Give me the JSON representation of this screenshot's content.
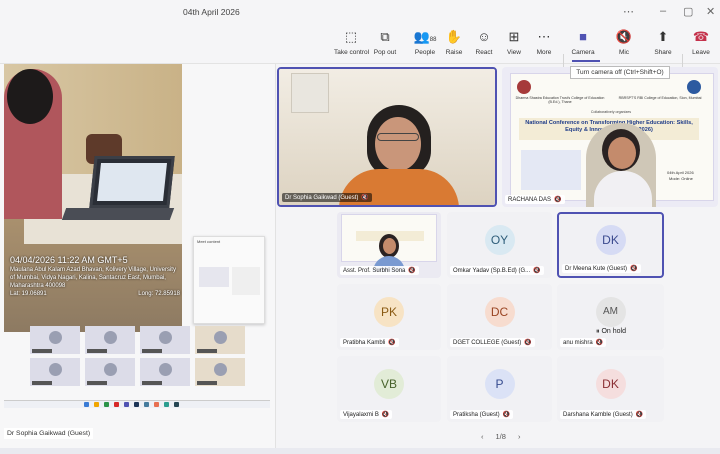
{
  "window": {
    "title": "04th April 2026"
  },
  "toolbar": {
    "take_control": "Take control",
    "pop_out": "Pop out",
    "people": "People",
    "people_count": "88",
    "raise": "Raise",
    "react": "React",
    "view": "View",
    "more": "More",
    "camera": "Camera",
    "mic": "Mic",
    "share": "Share",
    "leave": "Leave",
    "tooltip": "Turn camera off (Ctrl+Shift+O)"
  },
  "photo_overlay": {
    "timestamp": "04/04/2026 11:22 AM  GMT+5",
    "address": "Maulana Abul Kalam Azad Bhavan, Kolivery Village, University of Mumbai, Vidya Nagari, Kalina, Santacruz East, Mumbai, Maharashtra 400098",
    "lat": "Lat: 19.06891",
    "long": "Long: 72.85918"
  },
  "shared_window": {
    "header": "Meet content"
  },
  "left_name_tag": "Dr Sophia Gaikwad (Guest)",
  "slide": {
    "org": "Dharma Shastra Education Trust's College of Education (B.Ed.), Thane",
    "org2": "RBRSPT'S RBI College of Education, Sion, Mumbai",
    "collab": "Collaboratively organizes",
    "title": "National Conference on Transforming Higher Education: Skills, Equity & Innovation (NCHE 2026)",
    "date": "04th April 2026",
    "mode": "Mode: Online"
  },
  "tiles": [
    {
      "name": "Dr Sophia Gaikwad (Guest)",
      "selected": true
    },
    {
      "name": "RACHANA DAS",
      "selected": false
    },
    {
      "name": "Asst. Prof. Surbhi Sona",
      "selected": false
    },
    {
      "name": "Omkar Yadav (Sp.B.Ed) (G...",
      "initials": "OY",
      "bg": "#d9e9f2",
      "fg": "#2f5e7a",
      "selected": false
    },
    {
      "name": "Dr Meena Kute (Guest)",
      "initials": "DK",
      "bg": "#d6dbf4",
      "fg": "#3b4a8f",
      "selected": true
    },
    {
      "name": "Pratibha Kambli",
      "initials": "PK",
      "bg": "#f7e3c4",
      "fg": "#8a5a12",
      "selected": false
    },
    {
      "name": "DGET COLLEGE (Guest)",
      "initials": "DC",
      "bg": "#f7dccf",
      "fg": "#9a4523",
      "selected": false
    },
    {
      "name": "anu mishra",
      "initials": "AM",
      "bg": "#e4e4e4",
      "fg": "#555555",
      "selected": false
    },
    {
      "name": "Vijayalaxmi B",
      "initials": "VB",
      "bg": "#e2ecd7",
      "fg": "#46612a",
      "selected": false
    },
    {
      "name": "Pratiksha (Guest)",
      "initials": "P",
      "bg": "#dbe2f6",
      "fg": "#354b8f",
      "selected": false
    },
    {
      "name": "Darshana Kamble (Guest)",
      "initials": "DK",
      "bg": "#f5dede",
      "fg": "#8a2f34",
      "selected": false
    }
  ],
  "on_hold": "On hold",
  "pager": {
    "prev": "‹",
    "label": "1/8",
    "next": "›"
  }
}
